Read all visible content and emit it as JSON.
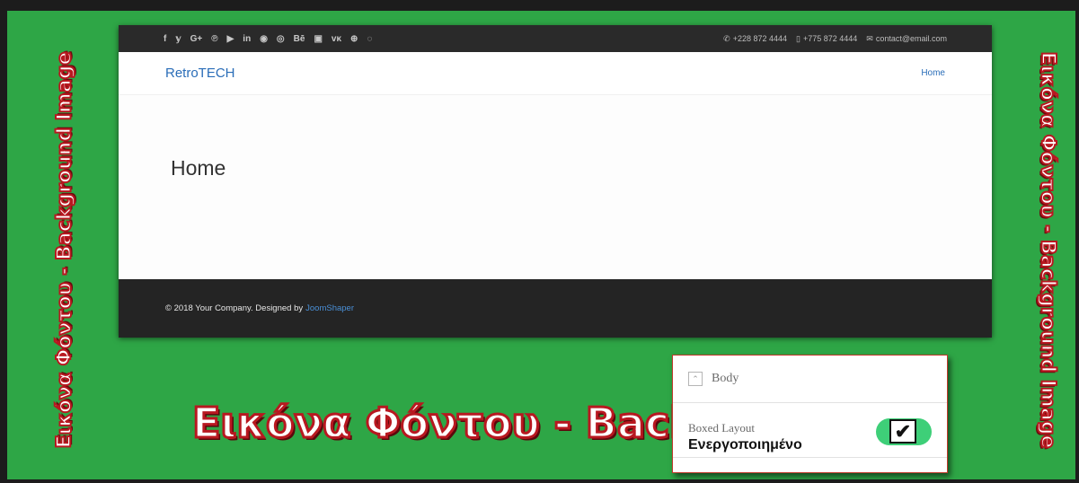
{
  "overlay": {
    "side_text": "Εικόνα Φόντου - Background Image",
    "big_text": "Εικόνα Φόντου - Backgr"
  },
  "topbar": {
    "social_icons": [
      "f",
      "𝕪",
      "G+",
      "℗",
      "▶",
      "in",
      "◉",
      "◎",
      "Bē",
      "▣",
      "ᴠκ",
      "⊕",
      "◌"
    ],
    "social_icon_names": [
      "facebook-icon",
      "twitter-icon",
      "google-plus-icon",
      "pinterest-icon",
      "youtube-icon",
      "linkedin-icon",
      "dribbble-icon",
      "instagram-icon",
      "behance-icon",
      "flickr-icon",
      "vk-icon",
      "skype-icon",
      "whatsapp-icon"
    ],
    "phone": "+228 872 4444",
    "mobile": "+775 872 4444",
    "email": "contact@email.com"
  },
  "navbar": {
    "logo": "RetroTECH",
    "menu": [
      "Home"
    ]
  },
  "hero": {
    "title": "Home"
  },
  "footer": {
    "copyright": "© 2018 Your Company. Designed by",
    "designer": "JoomShaper"
  },
  "panel": {
    "section_title": "Body",
    "field_label": "Boxed Layout",
    "field_status": "Ενεργοποιημένο",
    "toggle_on": true
  },
  "colors": {
    "background_green": "#2ea646",
    "brand_blue": "#2a6db8",
    "text_stroke_red": "#b81820",
    "toggle_green": "#3ecf78"
  }
}
